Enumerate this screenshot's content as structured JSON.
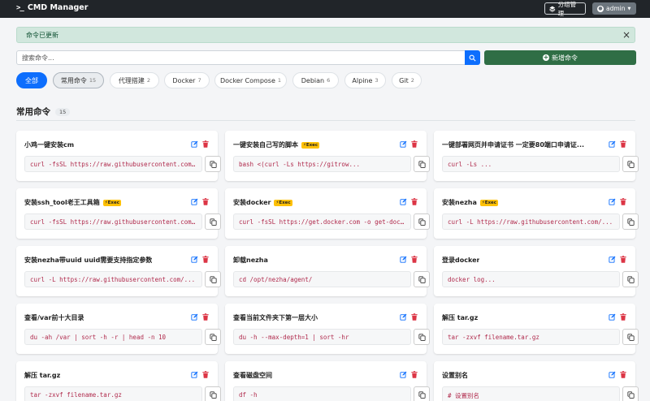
{
  "navbar": {
    "brand_icon": ">_",
    "brand": "CMD Manager",
    "group_manage": "分组管理",
    "user": "admin"
  },
  "alert": {
    "message": "命令已更新",
    "close": "×"
  },
  "search": {
    "placeholder": "搜索命令..."
  },
  "add_button": "新增命令",
  "filters": [
    {
      "label": "全部",
      "count": ""
    },
    {
      "label": "常用命令",
      "count": "15"
    },
    {
      "label": "代理搭建",
      "count": "2"
    },
    {
      "label": "Docker",
      "count": "7"
    },
    {
      "label": "Docker Compose",
      "count": "1"
    },
    {
      "label": "Debian",
      "count": "6"
    },
    {
      "label": "Alpine",
      "count": "3"
    },
    {
      "label": "Git",
      "count": "2"
    }
  ],
  "section": {
    "title": "常用命令",
    "count": "15"
  },
  "exec_label": "Exec",
  "cards": [
    {
      "title": "小鸡一键安装cm",
      "exec": false,
      "command": "curl -fsSL https://raw.githubusercontent.com/..."
    },
    {
      "title": "一键安装自己写的脚本",
      "exec": true,
      "command": "bash <(curl -Ls https://gitrow..."
    },
    {
      "title": "一键部署网页并申请证书 一定要80端口申请证...",
      "exec": false,
      "command": "curl -Ls ..."
    },
    {
      "title": "安装ssh_tool老王工具箱",
      "exec": true,
      "command": "curl -fsSL https://raw.githubusercontent.com/..."
    },
    {
      "title": "安装docker",
      "exec": true,
      "command": "curl -fsSL https://get.docker.com -o get-docker.sh"
    },
    {
      "title": "安装nezha",
      "exec": true,
      "command": "curl -L https://raw.githubusercontent.com/..."
    },
    {
      "title": "安装nezha带uuid uuid需要支持指定参数",
      "exec": false,
      "command": "curl -L https://raw.githubusercontent.com/..."
    },
    {
      "title": "卸载nezha",
      "exec": false,
      "command": "cd /opt/nezha/agent/"
    },
    {
      "title": "登录docker",
      "exec": false,
      "command": "docker log..."
    },
    {
      "title": "查看/var前十大目录",
      "exec": false,
      "command": "du -ah /var | sort -h -r | head -n 10"
    },
    {
      "title": "查看当前文件夹下第一层大小",
      "exec": false,
      "command": "du -h --max-depth=1 | sort -hr"
    },
    {
      "title": "解压 tar.gz",
      "exec": false,
      "command": "tar -zxvf filename.tar.gz"
    },
    {
      "title": "解压 tar.gz",
      "exec": false,
      "command": "tar -zxvf filename.tar.gz"
    },
    {
      "title": "查看磁盘空间",
      "exec": false,
      "command": "df -h"
    },
    {
      "title": "设置别名",
      "exec": false,
      "command": "# 设置别名"
    }
  ]
}
